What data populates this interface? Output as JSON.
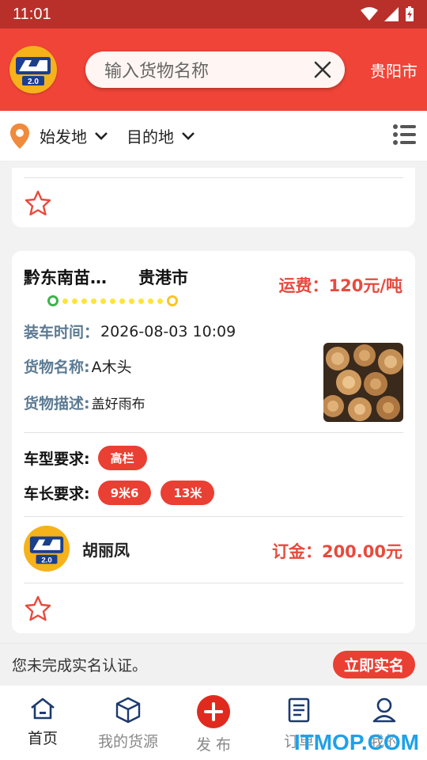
{
  "status": {
    "time": "11:01"
  },
  "header": {
    "logo_text": "2.0",
    "search_placeholder": "输入货物名称",
    "city": "贵阳市"
  },
  "filters": {
    "origin_label": "始发地",
    "destination_label": "目的地"
  },
  "listing": {
    "from": "黔东南苗…",
    "to": "贵港市",
    "freight": "运费：120元/吨",
    "load_time_key": "装车时间：",
    "load_time": "2026-08-03 10:09",
    "goods_name_key": "货物名称:",
    "goods_name": "A木头",
    "goods_desc_key": "货物描述:",
    "goods_desc": "盖好雨布",
    "vehicle_type_key": "车型要求:",
    "vehicle_types": [
      "高栏"
    ],
    "vehicle_length_key": "车长要求:",
    "vehicle_lengths": [
      "9米6",
      "13米"
    ],
    "poster_name": "胡丽凤",
    "deposit": "订金：200.00元"
  },
  "banner": {
    "message": "您未完成实名认证。",
    "button": "立即实名"
  },
  "tabs": [
    {
      "label": "首页",
      "icon": "home-icon"
    },
    {
      "label": "我的货源",
      "icon": "box-icon"
    },
    {
      "label": "发 布",
      "icon": "plus-icon"
    },
    {
      "label": "订单",
      "icon": "order-icon"
    },
    {
      "label": "我的",
      "icon": "user-icon"
    }
  ],
  "watermark": "ITMOP.COM",
  "colors": {
    "primary": "#ef4437",
    "status_bar": "#b92f2a",
    "accent_text": "#e84a3e",
    "label_blue": "#5b7a93"
  }
}
